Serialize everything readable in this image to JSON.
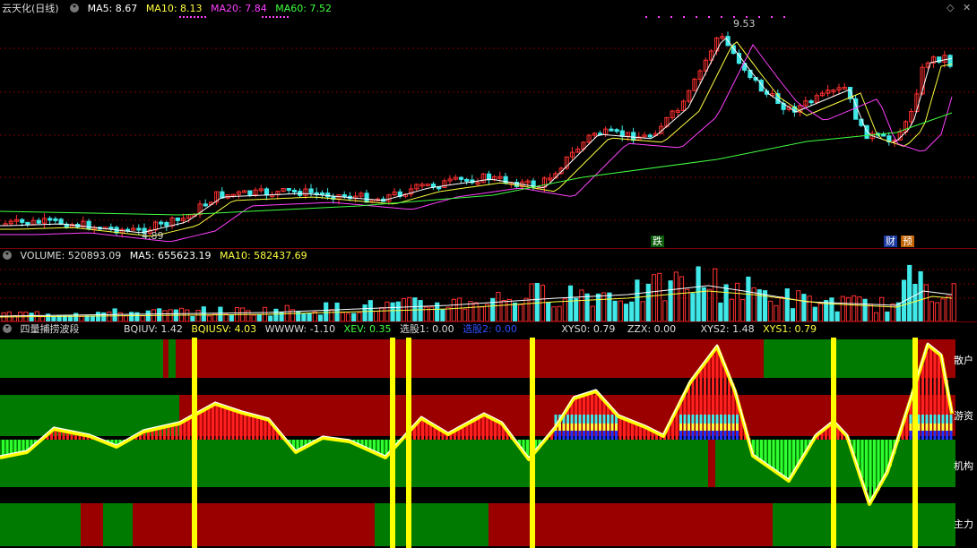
{
  "main_panel": {
    "title": "云天化(日线)",
    "ma5": "MA5: 8.67",
    "ma10": "MA10: 8.13",
    "ma20": "MA20: 7.84",
    "ma60": "MA60: 7.52",
    "high_label": "9.53",
    "low_label": "4.89",
    "tag_die": "跌",
    "tag_cai": "财",
    "tag_yu": "预",
    "corner_icons": [
      "diamond-icon",
      "close-icon"
    ]
  },
  "volume_panel": {
    "title": "VOLUME: 520893.09",
    "ma5": "MA5: 655623.19",
    "ma10": "MA10: 582437.69"
  },
  "indicator_panel": {
    "title": "四量捕捞波段",
    "bqiuv": "BQIUV: 1.42",
    "bqiusv": "BQIUSV: 4.03",
    "wwww": "WWWW: -1.10",
    "xev": "XEV: 0.35",
    "xg1": "选股1: 0.00",
    "xg2": "选股2: 0.00",
    "xys0": "XYS0: 0.79",
    "zzx": "ZZX: 0.00",
    "xys2": "XYS2: 1.48",
    "xys1": "XYS1: 0.79",
    "band_labels": [
      "散户",
      "游资",
      "机构",
      "主力"
    ]
  },
  "colors": {
    "up": "#ff3030",
    "down": "#40e8e8",
    "ma5": "#ffffff",
    "ma10": "#ffff40",
    "ma20": "#ff40ff",
    "ma60": "#40ff40",
    "red_band": "#9a0000",
    "green_band": "#007a00",
    "signal": "#ffff00"
  },
  "chart_data": [
    {
      "type": "candlestick",
      "title": "云天化(日线)",
      "series": [
        {
          "name": "MA5",
          "value": 8.67
        },
        {
          "name": "MA10",
          "value": 8.13
        },
        {
          "name": "MA20",
          "value": 7.84
        },
        {
          "name": "MA60",
          "value": 7.52
        }
      ],
      "annotations": [
        {
          "text": "9.53"
        },
        {
          "text": "4.89"
        }
      ]
    },
    {
      "type": "bar",
      "title": "VOLUME",
      "series": [
        {
          "name": "VOLUME",
          "value": 520893.09
        },
        {
          "name": "MA5",
          "value": 655623.19
        },
        {
          "name": "MA10",
          "value": 582437.69
        }
      ]
    },
    {
      "type": "bar",
      "title": "四量捕捞波段",
      "series": [
        {
          "name": "BQIUV",
          "value": 1.42
        },
        {
          "name": "BQIUSV",
          "value": 4.03
        },
        {
          "name": "WWWW",
          "value": -1.1
        },
        {
          "name": "XEV",
          "value": 0.35
        },
        {
          "name": "选股1",
          "value": 0.0
        },
        {
          "name": "选股2",
          "value": 0.0
        },
        {
          "name": "XYS0",
          "value": 0.79
        },
        {
          "name": "ZZX",
          "value": 0.0
        },
        {
          "name": "XYS2",
          "value": 1.48
        },
        {
          "name": "XYS1",
          "value": 0.79
        }
      ]
    }
  ]
}
